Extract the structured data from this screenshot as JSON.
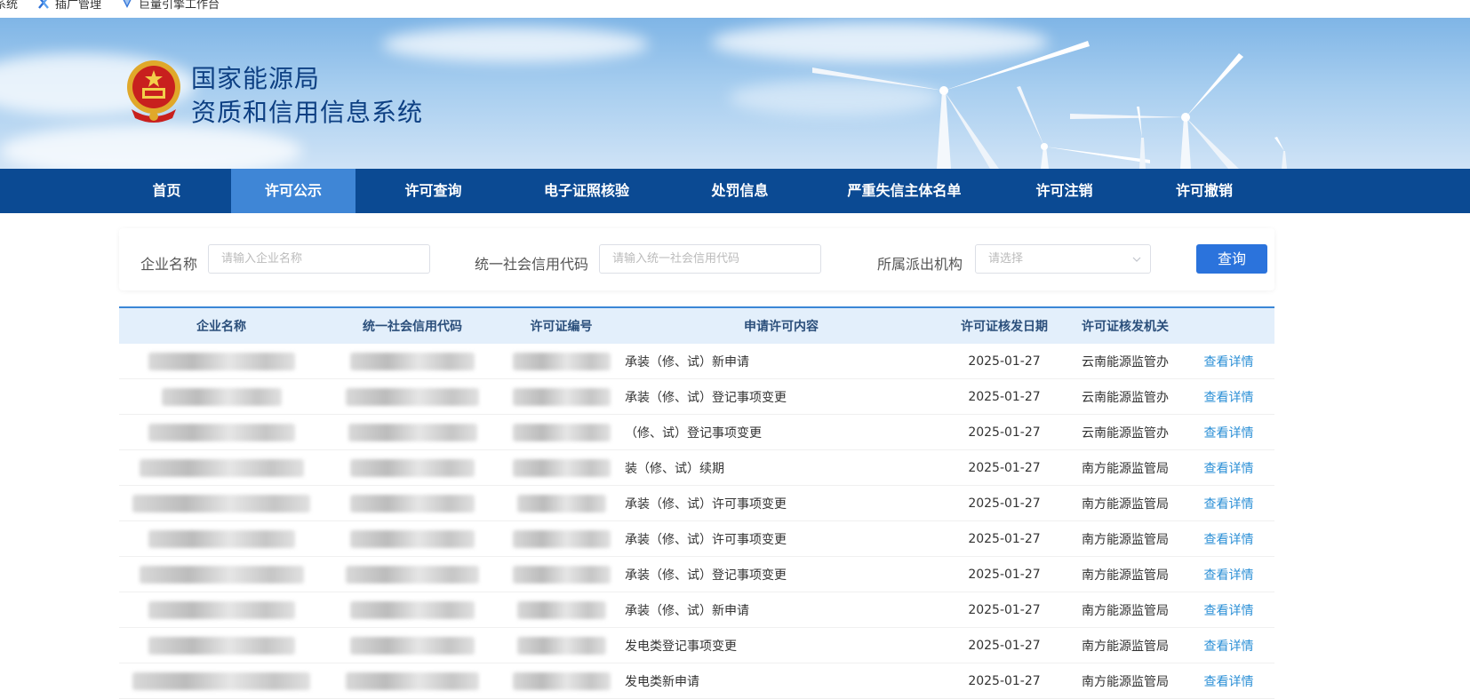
{
  "bookmarks": [
    {
      "label": "系统",
      "icon": "none"
    },
    {
      "label": "插广管理",
      "icon": "x-logo-icon"
    },
    {
      "label": "巨量引擎工作台",
      "icon": "engine-logo-icon"
    }
  ],
  "site": {
    "title_line1": "国家能源局",
    "title_line2": "资质和信用信息系统"
  },
  "nav": {
    "items": [
      {
        "label": "首页",
        "active": false
      },
      {
        "label": "许可公示",
        "active": true
      },
      {
        "label": "许可查询",
        "active": false
      },
      {
        "label": "电子证照核验",
        "active": false
      },
      {
        "label": "处罚信息",
        "active": false
      },
      {
        "label": "严重失信主体名单",
        "active": false
      },
      {
        "label": "许可注销",
        "active": false
      },
      {
        "label": "许可撤销",
        "active": false
      }
    ]
  },
  "search": {
    "company_label": "企业名称",
    "company_placeholder": "请输入企业名称",
    "credit_label": "统一社会信用代码",
    "credit_placeholder": "请输入统一社会信用代码",
    "org_label": "所属派出机构",
    "org_placeholder": "请选择",
    "query_button": "查询"
  },
  "table": {
    "headers": [
      "企业名称",
      "统一社会信用代码",
      "许可证编号",
      "申请许可内容",
      "许可证核发日期",
      "许可证核发机关",
      ""
    ],
    "rows": [
      {
        "content": "承装（修、试）新申请",
        "date": "2025-01-27",
        "org": "云南能源监管办",
        "action": "查看详情"
      },
      {
        "content": "承装（修、试）登记事项变更",
        "date": "2025-01-27",
        "org": "云南能源监管办",
        "action": "查看详情"
      },
      {
        "content": "（修、试）登记事项变更",
        "date": "2025-01-27",
        "org": "云南能源监管办",
        "action": "查看详情"
      },
      {
        "content": "装（修、试）续期",
        "date": "2025-01-27",
        "org": "南方能源监管局",
        "action": "查看详情"
      },
      {
        "content": "承装（修、试）许可事项变更",
        "date": "2025-01-27",
        "org": "南方能源监管局",
        "action": "查看详情"
      },
      {
        "content": "承装（修、试）许可事项变更",
        "date": "2025-01-27",
        "org": "南方能源监管局",
        "action": "查看详情"
      },
      {
        "content": "承装（修、试）登记事项变更",
        "date": "2025-01-27",
        "org": "南方能源监管局",
        "action": "查看详情"
      },
      {
        "content": "承装（修、试）新申请",
        "date": "2025-01-27",
        "org": "南方能源监管局",
        "action": "查看详情"
      },
      {
        "content": "发电类登记事项变更",
        "date": "2025-01-27",
        "org": "南方能源监管局",
        "action": "查看详情"
      },
      {
        "content": "发电类新申请",
        "date": "2025-01-27",
        "org": "南方能源监管局",
        "action": "查看详情"
      }
    ]
  },
  "colors": {
    "nav_bg": "#0b4a93",
    "nav_active": "#3f86d6",
    "primary_button": "#2b73dc",
    "link": "#2b8fd6",
    "table_header_bg": "#e3effb"
  }
}
